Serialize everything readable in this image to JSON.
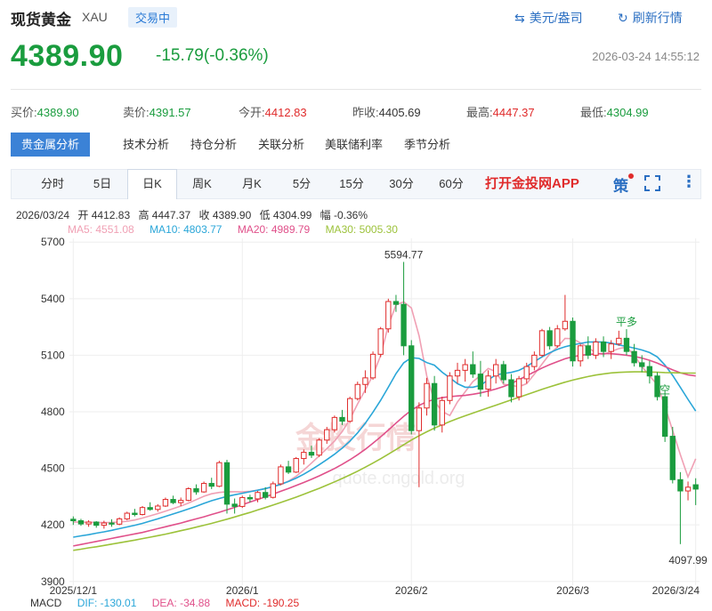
{
  "header": {
    "title": "现货黄金",
    "symbol": "XAU",
    "status": "交易中",
    "currency_label": "美元/盎司",
    "refresh_label": "刷新行情"
  },
  "quote": {
    "price": "4389.90",
    "change": "-15.79(-0.36%)",
    "timestamp": "2026-03-24 14:55:12"
  },
  "fields": [
    {
      "label": "买价:",
      "value": "4389.90",
      "tone": "g"
    },
    {
      "label": "卖价:",
      "value": "4391.57",
      "tone": "g"
    },
    {
      "label": "今开:",
      "value": "4412.83",
      "tone": "r"
    },
    {
      "label": "昨收:",
      "value": "4405.69",
      "tone": "k"
    },
    {
      "label": "最高:",
      "value": "4447.37",
      "tone": "r"
    },
    {
      "label": "最低:",
      "value": "4304.99",
      "tone": "g"
    }
  ],
  "tabs": [
    {
      "label": "贵金属分析",
      "active": true
    },
    {
      "label": "技术分析",
      "active": false
    },
    {
      "label": "持仓分析",
      "active": false
    },
    {
      "label": "关联分析",
      "active": false
    },
    {
      "label": "美联储利率",
      "active": false
    },
    {
      "label": "季节分析",
      "active": false
    }
  ],
  "periods": [
    {
      "label": "分时",
      "active": false
    },
    {
      "label": "5日",
      "active": false
    },
    {
      "label": "日K",
      "active": true
    },
    {
      "label": "周K",
      "active": false
    },
    {
      "label": "月K",
      "active": false
    },
    {
      "label": "5分",
      "active": false
    },
    {
      "label": "15分",
      "active": false
    },
    {
      "label": "30分",
      "active": false
    },
    {
      "label": "60分",
      "active": false
    }
  ],
  "toolbar": {
    "open_app": "打开金投网APP",
    "strategy": "策"
  },
  "ohlc": {
    "date": "2026/03/24",
    "open": "开 4412.83",
    "high": "高 4447.37",
    "close": "收 4389.90",
    "low": "低 4304.99",
    "amp": "幅 -0.36%"
  },
  "ma": {
    "ma5": "MA5: 4551.08",
    "ma10": "MA10: 4803.77",
    "ma20": "MA20: 4989.79",
    "ma30": "MA30: 5005.30"
  },
  "macd": {
    "label": "MACD",
    "dif": "DIF: -130.01",
    "dea": "DEA: -34.88",
    "macd": "MACD: -190.25"
  },
  "watermark": {
    "brand": "金投行情",
    "url": "quote.cngold.org"
  },
  "colors": {
    "up": "#e02b2b",
    "down": "#1a9c3e",
    "ma5": "#f0a0b4",
    "ma10": "#2aa6d8",
    "ma20": "#e0508a",
    "ma30": "#9cc23a"
  },
  "chart_data": {
    "type": "candlestick",
    "y_ticks": [
      5700,
      5400,
      5100,
      4800,
      4500,
      4200,
      3900
    ],
    "ylim": [
      3880,
      5720
    ],
    "x_ticks": [
      {
        "label": "2025/12/1",
        "index": 0
      },
      {
        "label": "2026/1",
        "index": 22
      },
      {
        "label": "2026/2",
        "index": 44
      },
      {
        "label": "2026/3",
        "index": 65
      },
      {
        "label": "2026/3/24",
        "index": 81
      }
    ],
    "annotations": [
      {
        "text": "5594.77",
        "index": 43,
        "value": 5594.77
      },
      {
        "text": "4097.99",
        "index": 80,
        "value": 4097.99
      },
      {
        "text": "平多",
        "index": 72,
        "value": 5210
      },
      {
        "text": "空",
        "index": 77,
        "value": 4850
      }
    ],
    "series": [
      {
        "name": "MA5",
        "values": [
          4215,
          4214,
          4214,
          4213,
          4212,
          4213,
          4215,
          4219,
          4226,
          4236,
          4248,
          4260,
          4273,
          4286,
          4300,
          4316,
          4334,
          4352,
          4365,
          4372,
          4376,
          4376,
          4375,
          4378,
          4384,
          4392,
          4402,
          4414,
          4432,
          4458,
          4491,
          4528,
          4566,
          4604,
          4645,
          4695,
          4760,
          4842,
          4916,
          4994,
          5098,
          5257,
          5367,
          5383,
          5351,
          5203,
          4990,
          4856,
          4802,
          4780,
          4852,
          4906,
          4960,
          4992,
          5030,
          5013,
          4946,
          4940,
          4933,
          4949,
          4999,
          5053,
          5106,
          5144,
          5189,
          5188,
          5165,
          5141,
          5112,
          5104,
          5120,
          5135,
          5143,
          5100,
          5040,
          4991,
          4943,
          4829,
          4700,
          4573,
          4454,
          4551
        ]
      },
      {
        "name": "MA10",
        "values": [
          4135,
          4142,
          4148,
          4156,
          4163,
          4171,
          4180,
          4189,
          4198,
          4208,
          4220,
          4232,
          4245,
          4258,
          4271,
          4285,
          4299,
          4314,
          4328,
          4340,
          4351,
          4360,
          4368,
          4376,
          4384,
          4393,
          4403,
          4415,
          4430,
          4448,
          4469,
          4493,
          4519,
          4546,
          4575,
          4607,
          4644,
          4688,
          4739,
          4797,
          4861,
          4930,
          5003,
          5060,
          5087,
          5083,
          5061,
          5047,
          5010,
          4980,
          4949,
          4930,
          4930,
          4940,
          4970,
          4996,
          5003,
          5009,
          5020,
          5040,
          5066,
          5091,
          5113,
          5131,
          5145,
          5155,
          5163,
          5170,
          5171,
          5170,
          5164,
          5155,
          5147,
          5138,
          5128,
          5114,
          5091,
          5048,
          4993,
          4930,
          4866,
          4804
        ]
      },
      {
        "name": "MA20",
        "values": [
          4088,
          4096,
          4104,
          4112,
          4120,
          4128,
          4136,
          4144,
          4152,
          4160,
          4170,
          4180,
          4190,
          4200,
          4210,
          4221,
          4232,
          4243,
          4255,
          4267,
          4280,
          4293,
          4307,
          4321,
          4335,
          4349,
          4363,
          4378,
          4393,
          4409,
          4425,
          4442,
          4460,
          4479,
          4499,
          4521,
          4545,
          4572,
          4601,
          4633,
          4667,
          4703,
          4740,
          4776,
          4808,
          4834,
          4853,
          4866,
          4875,
          4880,
          4884,
          4887,
          4893,
          4900,
          4910,
          4921,
          4934,
          4950,
          4970,
          4991,
          5012,
          5032,
          5050,
          5066,
          5081,
          5092,
          5099,
          5104,
          5107,
          5109,
          5108,
          5105,
          5100,
          5094,
          5085,
          5073,
          5058,
          5040,
          5022,
          5007,
          4996,
          4990
        ]
      },
      {
        "name": "MA30",
        "values": [
          4065,
          4071,
          4078,
          4084,
          4091,
          4098,
          4105,
          4112,
          4119,
          4127,
          4135,
          4143,
          4151,
          4160,
          4169,
          4178,
          4188,
          4198,
          4208,
          4219,
          4230,
          4242,
          4254,
          4266,
          4279,
          4292,
          4305,
          4319,
          4333,
          4347,
          4362,
          4378,
          4394,
          4411,
          4428,
          4446,
          4465,
          4485,
          4506,
          4528,
          4551,
          4575,
          4600,
          4625,
          4650,
          4673,
          4694,
          4713,
          4731,
          4748,
          4764,
          4779,
          4793,
          4807,
          4821,
          4835,
          4849,
          4863,
          4877,
          4891,
          4905,
          4919,
          4932,
          4945,
          4957,
          4968,
          4978,
          4987,
          4995,
          5001,
          5006,
          5009,
          5011,
          5012,
          5012,
          5011,
          5010,
          5008,
          5007,
          5006,
          5005,
          5005
        ]
      },
      {
        "name": "candles",
        "ohlc": [
          [
            4230,
            4245,
            4200,
            4222
          ],
          [
            4222,
            4232,
            4195,
            4205
          ],
          [
            4205,
            4225,
            4190,
            4215
          ],
          [
            4215,
            4220,
            4185,
            4198
          ],
          [
            4198,
            4222,
            4180,
            4210
          ],
          [
            4210,
            4230,
            4190,
            4204
          ],
          [
            4204,
            4240,
            4198,
            4232
          ],
          [
            4232,
            4270,
            4225,
            4262
          ],
          [
            4262,
            4285,
            4245,
            4255
          ],
          [
            4255,
            4300,
            4250,
            4292
          ],
          [
            4292,
            4320,
            4275,
            4282
          ],
          [
            4282,
            4310,
            4270,
            4300
          ],
          [
            4300,
            4345,
            4295,
            4335
          ],
          [
            4335,
            4355,
            4310,
            4318
          ],
          [
            4318,
            4345,
            4300,
            4330
          ],
          [
            4330,
            4400,
            4325,
            4392
          ],
          [
            4392,
            4415,
            4360,
            4375
          ],
          [
            4375,
            4430,
            4370,
            4420
          ],
          [
            4420,
            4450,
            4390,
            4405
          ],
          [
            4405,
            4540,
            4400,
            4530
          ],
          [
            4530,
            4545,
            4260,
            4310
          ],
          [
            4310,
            4340,
            4260,
            4298
          ],
          [
            4298,
            4355,
            4290,
            4345
          ],
          [
            4345,
            4360,
            4320,
            4338
          ],
          [
            4338,
            4380,
            4320,
            4372
          ],
          [
            4372,
            4400,
            4335,
            4346
          ],
          [
            4346,
            4430,
            4340,
            4418
          ],
          [
            4418,
            4520,
            4410,
            4508
          ],
          [
            4508,
            4540,
            4470,
            4480
          ],
          [
            4480,
            4560,
            4475,
            4552
          ],
          [
            4552,
            4600,
            4520,
            4585
          ],
          [
            4585,
            4620,
            4555,
            4570
          ],
          [
            4570,
            4660,
            4560,
            4650
          ],
          [
            4650,
            4720,
            4630,
            4705
          ],
          [
            4705,
            4780,
            4690,
            4770
          ],
          [
            4770,
            4810,
            4730,
            4750
          ],
          [
            4750,
            4880,
            4740,
            4870
          ],
          [
            4870,
            4960,
            4860,
            4945
          ],
          [
            4945,
            5020,
            4900,
            4980
          ],
          [
            4980,
            5120,
            4970,
            5105
          ],
          [
            5105,
            5250,
            5090,
            5240
          ],
          [
            5240,
            5400,
            5220,
            5385
          ],
          [
            5385,
            5420,
            5330,
            5370
          ],
          [
            5370,
            5595,
            5100,
            5150
          ],
          [
            5150,
            5180,
            4680,
            4700
          ],
          [
            4700,
            4850,
            4400,
            4820
          ],
          [
            4820,
            4980,
            4780,
            4950
          ],
          [
            4950,
            4990,
            4700,
            4730
          ],
          [
            4730,
            4880,
            4690,
            4860
          ],
          [
            4860,
            5010,
            4840,
            4990
          ],
          [
            4990,
            5060,
            4950,
            5020
          ],
          [
            5020,
            5080,
            4960,
            5050
          ],
          [
            5050,
            5120,
            4980,
            5000
          ],
          [
            5000,
            5070,
            4880,
            4920
          ],
          [
            4920,
            5020,
            4880,
            4990
          ],
          [
            4990,
            5080,
            4950,
            5050
          ],
          [
            5050,
            5070,
            4950,
            4970
          ],
          [
            4970,
            5000,
            4850,
            4880
          ],
          [
            4880,
            4990,
            4860,
            4975
          ],
          [
            4975,
            5060,
            4950,
            5040
          ],
          [
            5040,
            5120,
            5020,
            5100
          ],
          [
            5100,
            5240,
            5090,
            5230
          ],
          [
            5230,
            5250,
            5130,
            5150
          ],
          [
            5150,
            5260,
            5140,
            5240
          ],
          [
            5240,
            5420,
            5230,
            5280
          ],
          [
            5280,
            5300,
            5040,
            5070
          ],
          [
            5070,
            5160,
            5040,
            5150
          ],
          [
            5150,
            5200,
            5080,
            5100
          ],
          [
            5100,
            5190,
            5080,
            5170
          ],
          [
            5170,
            5200,
            5090,
            5120
          ],
          [
            5120,
            5180,
            5080,
            5160
          ],
          [
            5160,
            5230,
            5150,
            5190
          ],
          [
            5190,
            5210,
            5100,
            5120
          ],
          [
            5120,
            5160,
            5040,
            5060
          ],
          [
            5060,
            5100,
            5010,
            5040
          ],
          [
            5040,
            5070,
            4950,
            4990
          ],
          [
            4990,
            5010,
            4860,
            4880
          ],
          [
            4880,
            4900,
            4640,
            4670
          ],
          [
            4670,
            4720,
            4420,
            4440
          ],
          [
            4440,
            4480,
            4098,
            4380
          ],
          [
            4380,
            4430,
            4330,
            4400
          ],
          [
            4412.83,
            4447.37,
            4304.99,
            4389.9
          ]
        ]
      }
    ]
  }
}
